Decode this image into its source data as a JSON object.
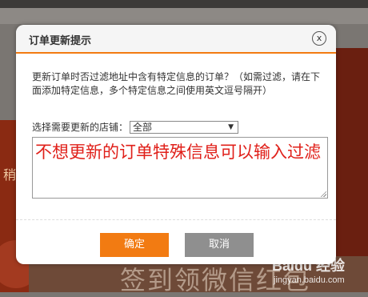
{
  "background": {
    "bottom_text": "签到领微信红包",
    "left_fragment": "稍",
    "watermark_brand": "Baidu 经验",
    "watermark_url": "jingyan.baidu.com"
  },
  "dialog": {
    "title": "订单更新提示",
    "close_label": "x",
    "description": "更新订单时否过滤地址中含有特定信息的订单？（如需过滤，请在下面添加特定信息，多个特定信息之间使用英文逗号隔开）",
    "shop_label": "选择需要更新的店铺：",
    "shop_selected": "全部",
    "textarea_value": "不想更新的订单特殊信息可以输入过滤",
    "confirm_label": "确定",
    "cancel_label": "取消"
  },
  "colors": {
    "accent": "#f27b12",
    "annotation_red": "#e0201a",
    "cancel_gray": "#8f8f8f"
  }
}
